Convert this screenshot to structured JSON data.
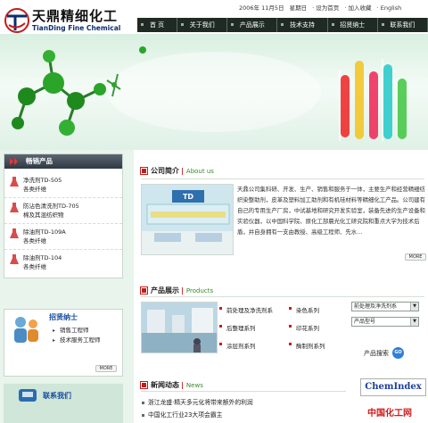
{
  "brand": {
    "name_cn": "天鼎精细化工",
    "name_en": "TianDing Fine Chemical",
    "mark": "TD"
  },
  "topbar": {
    "date": "2006年 11月5日",
    "weekday": "星期日",
    "set_home": "· 设为首页",
    "favorite": "· 加入收藏",
    "english": "· English"
  },
  "nav": [
    "首 页",
    "关于我们",
    "产品展示",
    "技术支持",
    "招贤纳士",
    "联系我们"
  ],
  "sidebar": {
    "products_title": "畅销产品",
    "products": [
      {
        "line1": "净洗剂TD-505",
        "line2": "各类纤维"
      },
      {
        "line1": "防沾色清洗剂TD-705",
        "line2": "棉及其混纺织物"
      },
      {
        "line1": "除油剂TD-109A",
        "line2": "各类纤维"
      },
      {
        "line1": "除油剂TD-104",
        "line2": "各类纤维"
      }
    ],
    "recruit_title": "招贤纳士",
    "recruit_items": [
      "销售工程师",
      "技术服务工程师"
    ],
    "more": "MORE",
    "contact_title": "联系我们"
  },
  "about": {
    "title_cn": "公司简介",
    "title_en": "About us",
    "text": "天鼎公司集科研、开发、生产、销售和服务于一体，主要生产和经营精细纺织染整助剂，皮革及塑料加工助剂和有机硅材料等精细化工产品。公司建有自己的专用生产厂房，中试基地和研究开发实验室，装备先进的生产设备和实验仪器，以中国科学院、原化工部晨光化工研究院和重点大学为技术后盾，并自身拥有一支由教授、高级工程师、先水...",
    "more": "MORE",
    "image_sign": "TD"
  },
  "products": {
    "title_cn": "产品展示",
    "title_en": "Products",
    "categories": [
      "前处理及净洗剂系",
      "染色系列",
      "后整理系列",
      "印花系列",
      "涂层剂系列",
      "酶制剂系列"
    ],
    "select1": "前处理及净洗剂系",
    "select2": "产品型号",
    "search_label": "产品搜索",
    "go": "GO"
  },
  "news": {
    "title_cn": "新闻动态",
    "title_en": "News",
    "items": [
      "浙江龙盛·精天多元化将带来额外的利润",
      "中国化工行业23大项会霸主"
    ]
  },
  "links": {
    "chemindex": "ChemIndex",
    "chemnet": "中国化工网"
  },
  "colors": {
    "nav_bg": "#1e2a22",
    "accent_red": "#c41c1c",
    "accent_green": "#3a8a2c",
    "link_blue": "#1a4fa0"
  }
}
